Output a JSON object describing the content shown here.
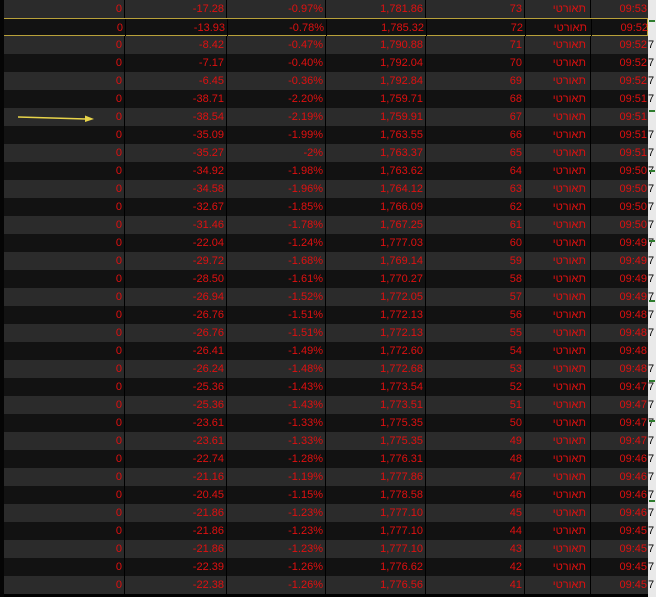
{
  "rows": [
    {
      "c1": "0",
      "c2": "-17.28",
      "c3": "-0.97%",
      "c4": "1,781.86",
      "c5": "73",
      "c6": "תאורטי",
      "c7": "09:53"
    },
    {
      "c1": "0",
      "c2": "-13.93",
      "c3": "-0.78%",
      "c4": "1,785.32",
      "c5": "72",
      "c6": "תאורטי",
      "c7": "09:52"
    },
    {
      "c1": "0",
      "c2": "-8.42",
      "c3": "-0.47%",
      "c4": "1,790.88",
      "c5": "71",
      "c6": "תאורטי",
      "c7": "09:52"
    },
    {
      "c1": "0",
      "c2": "-7.17",
      "c3": "-0.40%",
      "c4": "1,792.04",
      "c5": "70",
      "c6": "תאורטי",
      "c7": "09:52"
    },
    {
      "c1": "0",
      "c2": "-6.45",
      "c3": "-0.36%",
      "c4": "1,792.84",
      "c5": "69",
      "c6": "תאורטי",
      "c7": "09:52"
    },
    {
      "c1": "0",
      "c2": "-38.71",
      "c3": "-2.20%",
      "c4": "1,759.71",
      "c5": "68",
      "c6": "תאורטי",
      "c7": "09:51"
    },
    {
      "c1": "0",
      "c2": "-38.54",
      "c3": "-2.19%",
      "c4": "1,759.91",
      "c5": "67",
      "c6": "תאורטי",
      "c7": "09:51"
    },
    {
      "c1": "0",
      "c2": "-35.09",
      "c3": "-1.99%",
      "c4": "1,763.55",
      "c5": "66",
      "c6": "תאורטי",
      "c7": "09:51"
    },
    {
      "c1": "0",
      "c2": "-35.27",
      "c3": "-2%",
      "c4": "1,763.37",
      "c5": "65",
      "c6": "תאורטי",
      "c7": "09:51"
    },
    {
      "c1": "0",
      "c2": "-34.92",
      "c3": "-1.98%",
      "c4": "1,763.62",
      "c5": "64",
      "c6": "תאורטי",
      "c7": "09:50"
    },
    {
      "c1": "0",
      "c2": "-34.58",
      "c3": "-1.96%",
      "c4": "1,764.12",
      "c5": "63",
      "c6": "תאורטי",
      "c7": "09:50"
    },
    {
      "c1": "0",
      "c2": "-32.67",
      "c3": "-1.85%",
      "c4": "1,766.09",
      "c5": "62",
      "c6": "תאורטי",
      "c7": "09:50"
    },
    {
      "c1": "0",
      "c2": "-31.46",
      "c3": "-1.78%",
      "c4": "1,767.25",
      "c5": "61",
      "c6": "תאורטי",
      "c7": "09:50"
    },
    {
      "c1": "0",
      "c2": "-22.04",
      "c3": "-1.24%",
      "c4": "1,777.03",
      "c5": "60",
      "c6": "תאורטי",
      "c7": "09:49"
    },
    {
      "c1": "0",
      "c2": "-29.72",
      "c3": "-1.68%",
      "c4": "1,769.14",
      "c5": "59",
      "c6": "תאורטי",
      "c7": "09:49"
    },
    {
      "c1": "0",
      "c2": "-28.50",
      "c3": "-1.61%",
      "c4": "1,770.27",
      "c5": "58",
      "c6": "תאורטי",
      "c7": "09:49"
    },
    {
      "c1": "0",
      "c2": "-26.94",
      "c3": "-1.52%",
      "c4": "1,772.05",
      "c5": "57",
      "c6": "תאורטי",
      "c7": "09:49"
    },
    {
      "c1": "0",
      "c2": "-26.76",
      "c3": "-1.51%",
      "c4": "1,772.13",
      "c5": "56",
      "c6": "תאורטי",
      "c7": "09:48"
    },
    {
      "c1": "0",
      "c2": "-26.76",
      "c3": "-1.51%",
      "c4": "1,772.13",
      "c5": "55",
      "c6": "תאורטי",
      "c7": "09:48"
    },
    {
      "c1": "0",
      "c2": "-26.41",
      "c3": "-1.49%",
      "c4": "1,772.60",
      "c5": "54",
      "c6": "תאורטי",
      "c7": "09:48"
    },
    {
      "c1": "0",
      "c2": "-26.24",
      "c3": "-1.48%",
      "c4": "1,772.68",
      "c5": "53",
      "c6": "תאורטי",
      "c7": "09:48"
    },
    {
      "c1": "0",
      "c2": "-25.36",
      "c3": "-1.43%",
      "c4": "1,773.54",
      "c5": "52",
      "c6": "תאורטי",
      "c7": "09:47"
    },
    {
      "c1": "0",
      "c2": "-25.36",
      "c3": "-1.43%",
      "c4": "1,773.51",
      "c5": "51",
      "c6": "תאורטי",
      "c7": "09:47"
    },
    {
      "c1": "0",
      "c2": "-23.61",
      "c3": "-1.33%",
      "c4": "1,775.35",
      "c5": "50",
      "c6": "תאורטי",
      "c7": "09:47"
    },
    {
      "c1": "0",
      "c2": "-23.61",
      "c3": "-1.33%",
      "c4": "1,775.35",
      "c5": "49",
      "c6": "תאורטי",
      "c7": "09:47"
    },
    {
      "c1": "0",
      "c2": "-22.74",
      "c3": "-1.28%",
      "c4": "1,776.31",
      "c5": "48",
      "c6": "תאורטי",
      "c7": "09:46"
    },
    {
      "c1": "0",
      "c2": "-21.16",
      "c3": "-1.19%",
      "c4": "1,777.86",
      "c5": "47",
      "c6": "תאורטי",
      "c7": "09:46"
    },
    {
      "c1": "0",
      "c2": "-20.45",
      "c3": "-1.15%",
      "c4": "1,778.58",
      "c5": "46",
      "c6": "תאורטי",
      "c7": "09:46"
    },
    {
      "c1": "0",
      "c2": "-21.86",
      "c3": "-1.23%",
      "c4": "1,777.10",
      "c5": "45",
      "c6": "תאורטי",
      "c7": "09:46"
    },
    {
      "c1": "0",
      "c2": "-21.86",
      "c3": "-1.23%",
      "c4": "1,777.10",
      "c5": "44",
      "c6": "תאורטי",
      "c7": "09:45"
    },
    {
      "c1": "0",
      "c2": "-21.86",
      "c3": "-1.23%",
      "c4": "1,777.10",
      "c5": "43",
      "c6": "תאורטי",
      "c7": "09:45"
    },
    {
      "c1": "0",
      "c2": "-22.39",
      "c3": "-1.26%",
      "c4": "1,776.62",
      "c5": "42",
      "c6": "תאורטי",
      "c7": "09:45"
    },
    {
      "c1": "0",
      "c2": "-22.38",
      "c3": "-1.26%",
      "c4": "1,776.56",
      "c5": "41",
      "c6": "תאורטי",
      "c7": "09:45"
    }
  ],
  "selected_row": 1,
  "right_strip_chars": [
    "",
    "",
    "7",
    "7",
    "7",
    "7",
    "",
    "7",
    "7",
    "7",
    "7",
    "7",
    "7",
    "7",
    "7",
    "7",
    "7",
    "7",
    "7",
    "",
    "7",
    "7",
    "7",
    "7",
    "7",
    "7",
    "7",
    "7",
    "7",
    "7",
    "7",
    "7",
    "7"
  ],
  "colors": {
    "text": "#e01010",
    "row_odd": "#2b2b2b",
    "row_even": "#121212",
    "selection": "#b8a13a",
    "arrow": "#e8d44a"
  }
}
